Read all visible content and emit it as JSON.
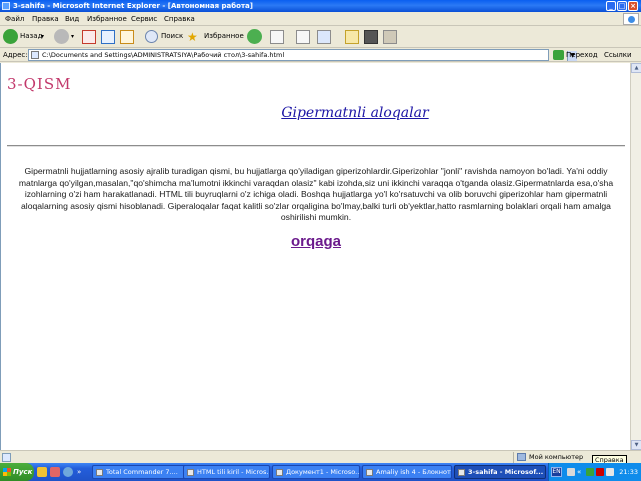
{
  "window": {
    "title": "3-sahifa - Microsoft Internet Explorer - [Автономная работа]",
    "controls": [
      "minimize",
      "maximize",
      "close"
    ]
  },
  "menu": [
    "Файл",
    "Правка",
    "Вид",
    "Избранное",
    "Сервис",
    "Справка"
  ],
  "toolbar": {
    "back_label": "Назад",
    "search_label": "Поиск",
    "favorites_label": "Избранное"
  },
  "address": {
    "label": "Адрес:",
    "value": "C:\\Documents and Settings\\ADMINISTRATSIYA\\Рабочий стол\\3-sahifa.html",
    "go_label": "Переход",
    "links_label": "Ссылки"
  },
  "page": {
    "section_heading": "3-QISM",
    "title": "Gipermatnli aloqalar",
    "body": "Gipermatnli hujjatlarning asosiy ajralib turadigan qismi, bu hujjatlarga qo'yiladigan giperizohlardir.Giperizohlar \"jonli\" ravishda namoyon bo'ladi. Ya'ni oddiy matnlarga qo'yilgan,masalan,\"qo'shimcha ma'lumotni ikkinchi varaqdan olasiz\" kabi izohda,siz uni ikkinchi varaqqa o'tganda olasiz.Gipermatnlarda esa,o'sha izohlarning o'zi ham harakatlanadi. HTML tili buyruqlarni o'z ichiga oladi. Boshqa hujjatlarga yo'l ko'rsatuvchi va olib boruvchi giperizohlar ham gipermatnli aloqalarning asosiy qismi hisoblanadi. Giperaloqalar faqat kalitli so'zlar orqaligina bo'lmay,balki turli ob'yektlar,hatto rasmlarning bolaklari orqali ham amalga oshirilishi mumkin.",
    "back_link": "orqaga"
  },
  "status": {
    "zone": "Мой компьютер",
    "tooltip": "Справка"
  },
  "taskbar": {
    "start_label": "Пуск",
    "tasks": [
      "Total Commander 7....",
      "HTML tili kiril - Micros...",
      "Документ1 - Microso...",
      "Amaliy ish 4 - Блокнот",
      "3-sahifa - Microsof..."
    ],
    "language": "EN",
    "clock": "21:33"
  },
  "colors": {
    "section_heading": "#c2386b",
    "title_link": "#1b14a5",
    "back_link": "#6b1a8c",
    "titlebar": "#0a5ef0"
  }
}
